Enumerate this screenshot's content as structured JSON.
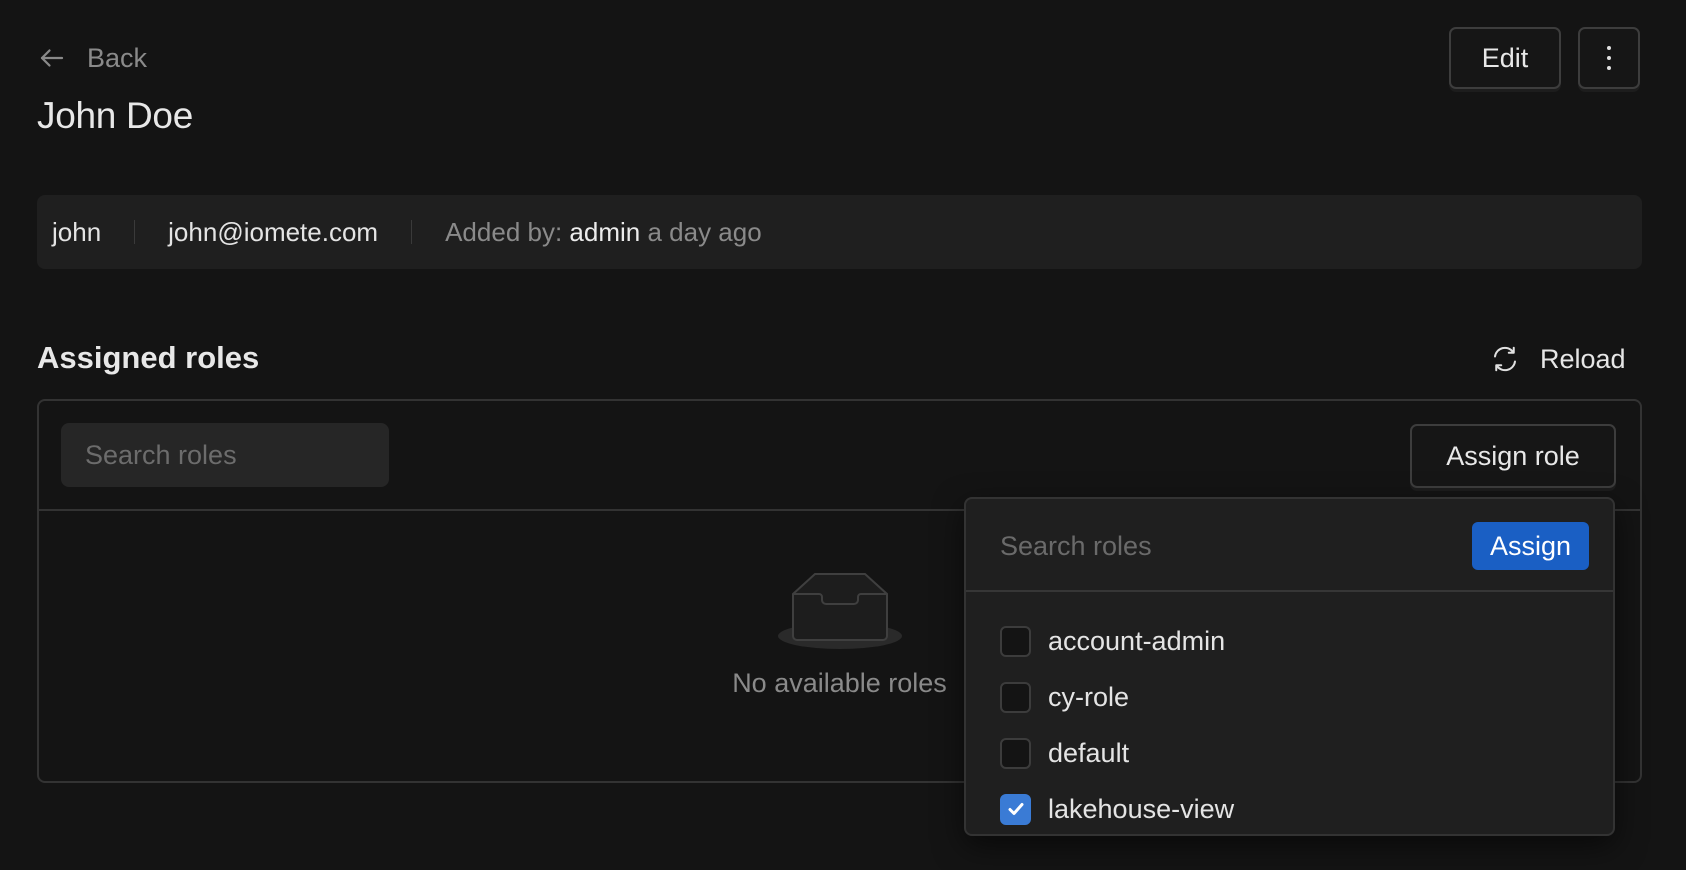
{
  "header": {
    "back_label": "Back",
    "title": "John Doe",
    "edit_label": "Edit"
  },
  "info": {
    "username": "john",
    "email": "john@iomete.com",
    "added_by_prefix": "Added by:",
    "added_by_user": "admin",
    "added_when": "a day ago"
  },
  "roles_section": {
    "title": "Assigned roles",
    "reload_label": "Reload",
    "search_placeholder": "Search roles",
    "assign_role_label": "Assign role",
    "empty_text": "No available roles"
  },
  "assign_dropdown": {
    "search_placeholder": "Search roles",
    "assign_label": "Assign",
    "accent_color": "#1a5fc4",
    "options": [
      {
        "label": "account-admin",
        "checked": false
      },
      {
        "label": "cy-role",
        "checked": false
      },
      {
        "label": "default",
        "checked": false
      },
      {
        "label": "lakehouse-view",
        "checked": true
      }
    ]
  }
}
